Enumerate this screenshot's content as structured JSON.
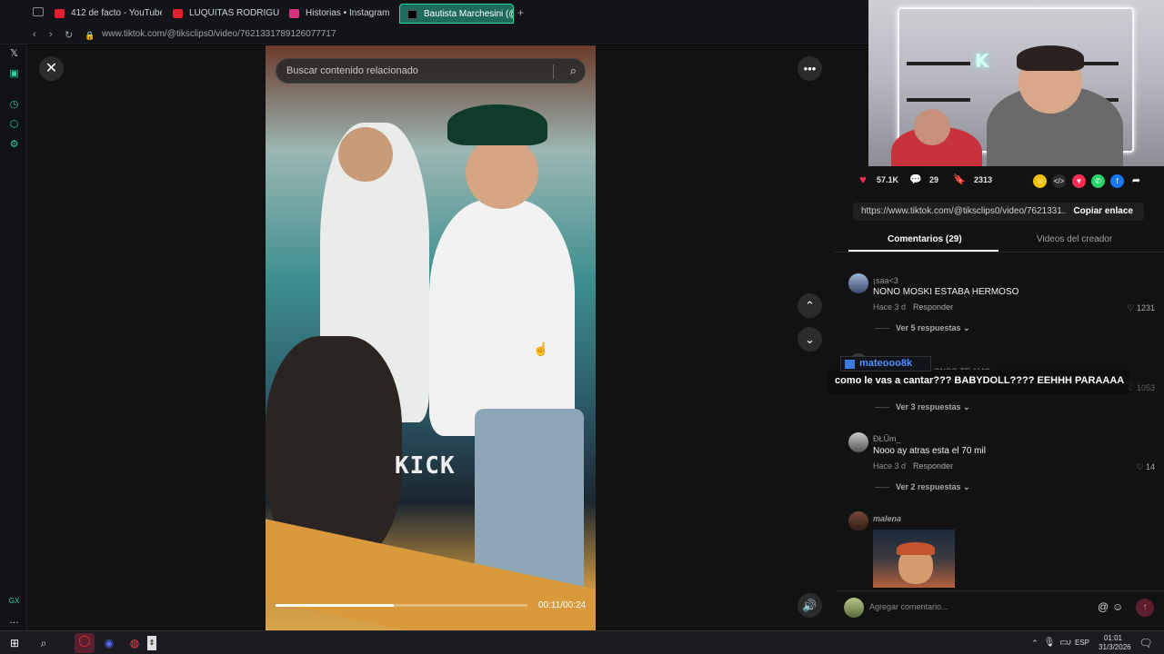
{
  "tabs": [
    {
      "label": "412 de facto - YouTube",
      "icon": "youtube-icon",
      "color": "#e3202d"
    },
    {
      "label": "LUQUITAS RODRIGUEZ Y",
      "icon": "youtube-icon",
      "color": "#e3202d"
    },
    {
      "label": "Historias • Instagram",
      "icon": "instagram-icon",
      "color": "#d8327f"
    },
    {
      "label": "Bautista Marchesini (@",
      "icon": "tiktok-icon",
      "color": "#000000"
    }
  ],
  "address": {
    "url": "www.tiktok.com/@tiksclips0/video/7621331789126077717"
  },
  "sidebar": {
    "bottom_label": "GX"
  },
  "video": {
    "search_placeholder": "Buscar contenido relacionado",
    "watermark": "KICK",
    "time": "00:11/00:24",
    "progress_fraction": 0.47
  },
  "stats": {
    "likes": "57.1K",
    "comments": "29",
    "saves": "2313"
  },
  "share_icons": [
    "embed-icon",
    "share-tiktok-icon",
    "whatsapp-icon",
    "facebook-icon",
    "forward-icon"
  ],
  "link": {
    "url": "https://www.tiktok.com/@tiksclips0/video/7621331...",
    "copy_label": "Copiar enlace"
  },
  "tabs_panel": {
    "comments": "Comentarios (29)",
    "creator": "Videos del creador"
  },
  "comments": [
    {
      "user": "¡saa<3",
      "text": "NONO MOSKI ESTABA HERMOSO",
      "time": "Hace 3 d",
      "reply": "Responder",
      "likes": "1231",
      "more": "Ver 5 respuestas"
    },
    {
      "user": "",
      "text": "",
      "time": "",
      "reply": "",
      "likes": "1053",
      "more": "Ver 3 respuestas"
    },
    {
      "user": "ÐŁŪm_",
      "text": "Nooo ay atras esta el 70 mil",
      "time": "Hace 3 d",
      "reply": "Responder",
      "likes": "14",
      "more": "Ver 2 respuestas"
    },
    {
      "user": "malena"
    }
  ],
  "behind_text": "...LONSO TE AMO",
  "overlay": {
    "name": "mateooo8k",
    "message": "como le vas a cantar??? BABYDOLL???? EEHHH PARAAAA"
  },
  "comment_input": {
    "placeholder": "Agregar comentario..."
  },
  "taskbar": {
    "lang": "ESP",
    "time": "01:01",
    "date": "31/3/2026"
  },
  "colors": {
    "accent": "#1fd3a2",
    "like": "#fe2c55",
    "link_blue": "#4c8fff"
  }
}
